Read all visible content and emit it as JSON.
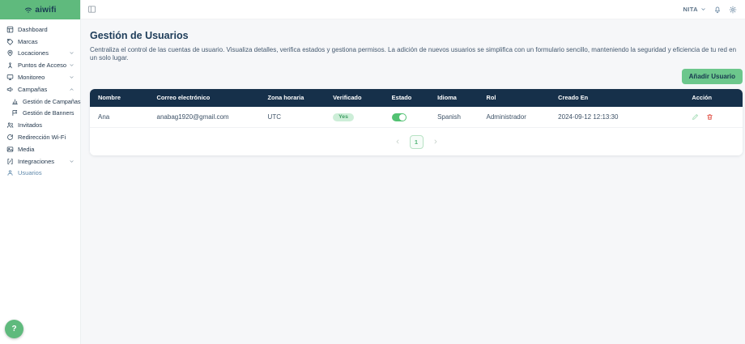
{
  "brand": {
    "logo_text": "aiwifi"
  },
  "topbar": {
    "user_name": "NITA"
  },
  "sidebar": {
    "items": [
      {
        "label": "Dashboard"
      },
      {
        "label": "Marcas"
      },
      {
        "label": "Locaciones"
      },
      {
        "label": "Puntos de Acceso"
      },
      {
        "label": "Monitoreo"
      },
      {
        "label": "Campañas"
      },
      {
        "label": "Gestión de Campañas"
      },
      {
        "label": "Gestión de Banners"
      },
      {
        "label": "Invitados"
      },
      {
        "label": "Redirección Wi-Fi"
      },
      {
        "label": "Media"
      },
      {
        "label": "Integraciones"
      },
      {
        "label": "Usuarios"
      }
    ]
  },
  "page": {
    "title": "Gestión de Usuarios",
    "subtitle": "Centraliza el control de las cuentas de usuario. Visualiza detalles, verifica estados y gestiona permisos. La adición de nuevos usuarios se simplifica con un formulario sencillo, manteniendo la seguridad y eficiencia de tu red en un solo lugar.",
    "add_button_label": "Añadir Usuario"
  },
  "table": {
    "columns": [
      "Nombre",
      "Correo electrónico",
      "Zona horaria",
      "Verificado",
      "Estado",
      "Idioma",
      "Rol",
      "Creado En",
      "Acción"
    ],
    "rows": [
      {
        "nombre": "Ana",
        "correo": "anabag1920@gmail.com",
        "zona_horaria": "UTC",
        "verificado": "Yes",
        "estado": "on",
        "idioma": "Spanish",
        "rol": "Administrador",
        "creado_en": "2024-09-12 12:13:30"
      }
    ],
    "pagination": {
      "current_page": "1"
    }
  },
  "help": {
    "label": "?"
  },
  "colors": {
    "brand_green": "#5fba7d",
    "button_green": "#6cc78c",
    "header_navy": "#16304a",
    "active_item_blue": "#5d87aa",
    "toggle_on_green": "#52c272",
    "badge_green_bg": "#cdeed8",
    "badge_green_text": "#3f9e63",
    "delete_red": "#e2574c"
  }
}
